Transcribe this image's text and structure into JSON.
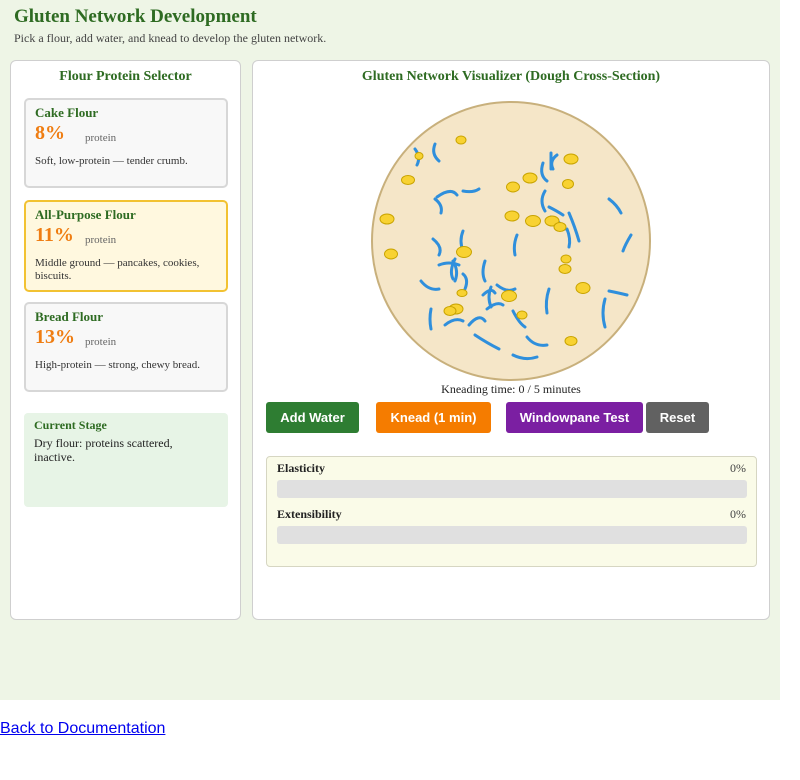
{
  "header": {
    "title": "Gluten Network Development",
    "subtitle": "Pick a flour, add water, and knead to develop the gluten network."
  },
  "selector": {
    "title": "Flour Protein Selector",
    "protein_label": "protein",
    "flours": [
      {
        "name": "Cake Flour",
        "protein": "8%",
        "description": "Soft, low-protein — tender crumb.",
        "selected": false
      },
      {
        "name": "All-Purpose Flour",
        "protein": "11%",
        "description": "Middle ground — pancakes, cookies, biscuits.",
        "selected": true
      },
      {
        "name": "Bread Flour",
        "protein": "13%",
        "description": "High-protein — strong, chewy bread.",
        "selected": false
      }
    ]
  },
  "stage": {
    "title": "Current Stage",
    "text": "Dry flour: proteins scattered, inactive."
  },
  "visualizer": {
    "title": "Gluten Network Visualizer  (Dough Cross-Section)",
    "knead_time": "Kneading time: 0 / 5 minutes"
  },
  "controls": {
    "add_water": "Add Water",
    "knead": "Knead (1 min)",
    "windowpane": "Windowpane Test",
    "reset": "Reset"
  },
  "metrics": {
    "elasticity": {
      "label": "Elasticity",
      "value": "0%",
      "fraction": 0
    },
    "extensibility": {
      "label": "Extensibility",
      "value": "0%",
      "fraction": 0
    }
  },
  "footer": {
    "back_link": "Back to Documentation"
  },
  "colors": {
    "dough_fill": "#f5e6c8",
    "dough_border": "#c8b07c",
    "strand": "#2f8fdc",
    "granule_fill": "#f8d232",
    "granule_stroke": "#c9a400"
  }
}
